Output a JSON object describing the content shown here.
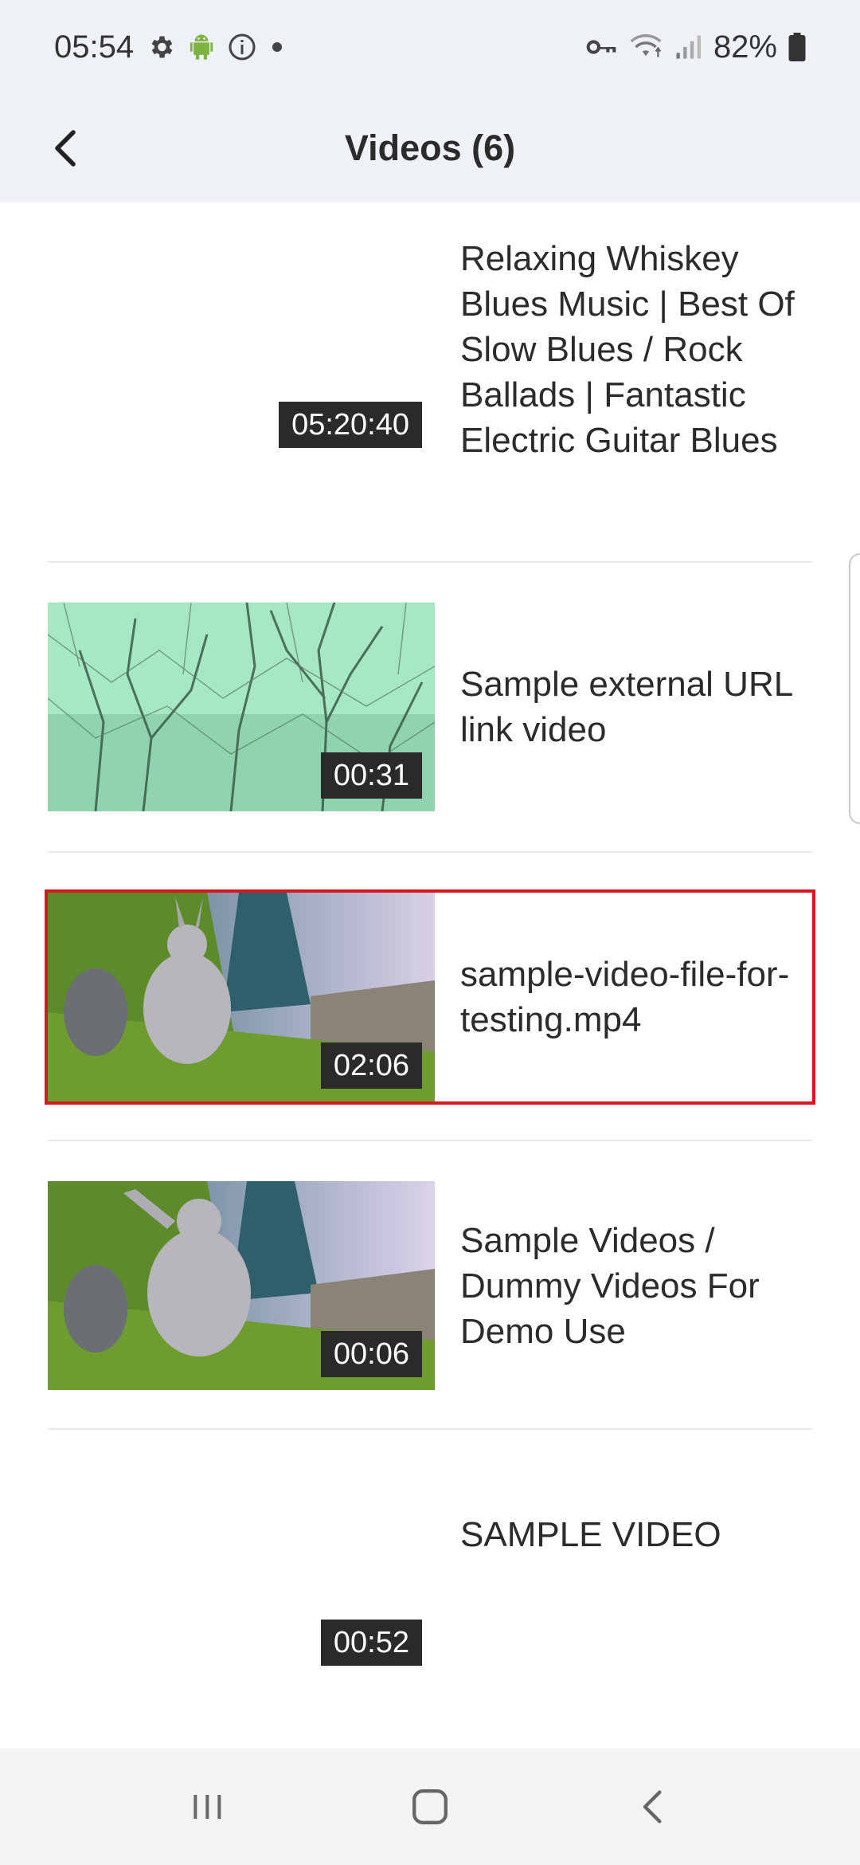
{
  "status_bar": {
    "time": "05:54",
    "battery": "82%",
    "icons": [
      "gear-icon",
      "android-icon",
      "info-icon",
      "dot-icon",
      "key-icon",
      "wifi-icon",
      "signal-icon",
      "battery-icon"
    ]
  },
  "app_bar": {
    "title": "Videos (6)",
    "back_icon": "chevron-left-icon"
  },
  "videos": [
    {
      "title": "Relaxing Whiskey Blues Music | Best Of Slow Blues / Rock Ballads | Fantastic Electric Guitar Blues",
      "duration": "05:20:40",
      "thumbnail": "none"
    },
    {
      "title": "Sample external URL link video",
      "duration": "00:31",
      "thumbnail": "winter-trees"
    },
    {
      "title": "sample-video-file-for-testing.mp4",
      "duration": "02:06",
      "thumbnail": "bunny-standing",
      "selected": true
    },
    {
      "title": "Sample Videos / Dummy Videos For Demo Use",
      "duration": "00:06",
      "thumbnail": "bunny-waving"
    },
    {
      "title": "SAMPLE VIDEO",
      "duration": "00:52",
      "thumbnail": "none"
    }
  ],
  "nav_bar": {
    "icons": [
      "recents-icon",
      "home-icon",
      "back-icon"
    ]
  },
  "colors": {
    "header_bg": "#eef2f6",
    "selection_outline": "#d9161c",
    "duration_bg": "#2c2a28"
  }
}
